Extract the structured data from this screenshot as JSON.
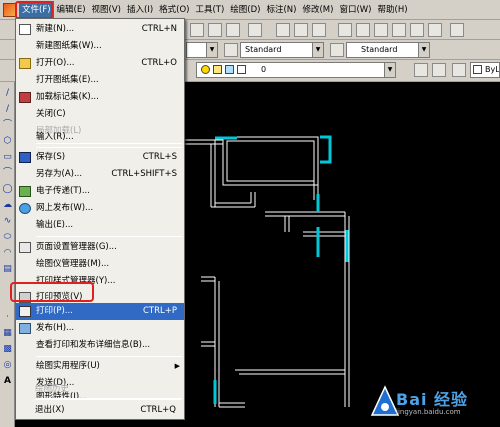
{
  "menubar": {
    "items": [
      "文件(F)",
      "编辑(E)",
      "视图(V)",
      "插入(I)",
      "格式(O)",
      "工具(T)",
      "绘图(D)",
      "标注(N)",
      "修改(M)",
      "窗口(W)",
      "帮助(H)"
    ]
  },
  "toolbar": {
    "style_combo_1": "Standard",
    "style_combo_2": "Standard",
    "layer_value": "0",
    "bylayer": "ByL"
  },
  "file_menu": {
    "items": [
      {
        "label": "新建(N)...",
        "shortcut": "CTRL+N",
        "icon": "new-file-icon"
      },
      {
        "label": "新建图纸集(W)...",
        "shortcut": "",
        "icon": ""
      },
      {
        "label": "打开(O)...",
        "shortcut": "CTRL+O",
        "icon": "open-folder-icon"
      },
      {
        "label": "打开图纸集(E)...",
        "shortcut": "",
        "icon": ""
      },
      {
        "label": "加载标记集(K)...",
        "shortcut": "",
        "icon": "markup-icon"
      },
      {
        "label": "关闭(C)",
        "shortcut": "",
        "icon": ""
      },
      {
        "label": "局部加载(L)",
        "shortcut": "",
        "icon": "",
        "disabled": true
      },
      {
        "label": "输入(R)...",
        "shortcut": "",
        "icon": ""
      },
      {
        "label": "保存(S)",
        "shortcut": "CTRL+S",
        "icon": "save-icon"
      },
      {
        "label": "另存为(A)...",
        "shortcut": "CTRL+SHIFT+S",
        "icon": ""
      },
      {
        "label": "电子传递(T)...",
        "shortcut": "",
        "icon": "etransmit-icon"
      },
      {
        "label": "网上发布(W)...",
        "shortcut": "",
        "icon": "publish-web-icon"
      },
      {
        "label": "输出(E)...",
        "shortcut": "",
        "icon": ""
      },
      {
        "label": "页面设置管理器(G)...",
        "shortcut": "",
        "icon": "page-setup-icon"
      },
      {
        "label": "绘图仪管理器(M)...",
        "shortcut": "",
        "icon": ""
      },
      {
        "label": "打印样式管理器(Y)...",
        "shortcut": "",
        "icon": ""
      },
      {
        "label": "打印预览(V)",
        "shortcut": "",
        "icon": "print-preview-icon"
      },
      {
        "label": "打印(P)...",
        "shortcut": "CTRL+P",
        "icon": "print-icon",
        "selected": true
      },
      {
        "label": "发布(H)...",
        "shortcut": "",
        "icon": "publish-icon"
      },
      {
        "label": "查看打印和发布详细信息(B)...",
        "shortcut": "",
        "icon": ""
      },
      {
        "label": "绘图实用程序(U)",
        "shortcut": "",
        "icon": "",
        "submenu": true
      },
      {
        "label": "发送(D)...",
        "shortcut": "",
        "icon": ""
      },
      {
        "label": "图形特性(I)...",
        "shortcut": "",
        "icon": ""
      },
      {
        "label": "绘图历史",
        "shortcut": "",
        "icon": "",
        "disabled": true
      },
      {
        "label": "退出(X)",
        "shortcut": "CTRL+Q",
        "icon": ""
      }
    ]
  },
  "watermark": {
    "text": "Bai 经验",
    "url": "jingyan.baidu.com"
  },
  "colors": {
    "menu_selected": "#316ac5",
    "highlight_box": "#e02020",
    "cad_cyan": "#00c8d8"
  }
}
